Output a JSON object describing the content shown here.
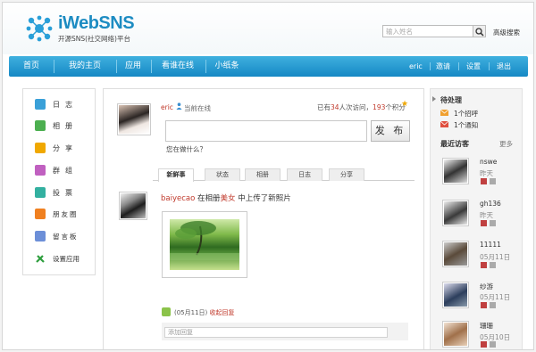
{
  "header": {
    "brand": "iWebSNS",
    "subtitle": "开源SNS(社交网络)平台",
    "search_placeholder": "输入姓名",
    "advanced_search": "高级搜索"
  },
  "nav": {
    "items": [
      {
        "label": "首页"
      },
      {
        "label": "我的主页"
      },
      {
        "label": "应用"
      },
      {
        "label": "看谁在线"
      },
      {
        "label": "小纸条"
      }
    ],
    "user": "eric",
    "invite": "邀请",
    "settings": "设置",
    "logout": "退出"
  },
  "sidebar": {
    "items": [
      {
        "label": "日志",
        "icon": "journal-icon",
        "color": "#3aa0d8"
      },
      {
        "label": "相册",
        "icon": "album-icon",
        "color": "#4caf50"
      },
      {
        "label": "分享",
        "icon": "share-icon",
        "color": "#f0a800"
      },
      {
        "label": "群组",
        "icon": "group-icon",
        "color": "#c060c0"
      },
      {
        "label": "投票",
        "icon": "vote-icon",
        "color": "#33b0a0"
      },
      {
        "label": "朋友圈",
        "icon": "friends-icon",
        "color": "#f08020"
      },
      {
        "label": "留言板",
        "icon": "message-board-icon",
        "color": "#6c8fd8"
      },
      {
        "label": "设置应用",
        "icon": "settings-tools-icon",
        "color": "#2e9e3e"
      }
    ]
  },
  "profile": {
    "username": "eric",
    "status": "当前在线",
    "visits_prefix": "已有",
    "visits_count": "34",
    "visits_mid": "人次访问，",
    "points": "193",
    "points_suffix": "个积分"
  },
  "composer": {
    "publish_label": "发 布",
    "hint": "您在做什么？"
  },
  "tabs": [
    {
      "label": "新鲜事",
      "active": true
    },
    {
      "label": "状态",
      "active": false
    },
    {
      "label": "相册",
      "active": false
    },
    {
      "label": "日志",
      "active": false
    },
    {
      "label": "分享",
      "active": false
    }
  ],
  "feed": {
    "author": "baiyecao",
    "action_prefix": "在相册",
    "album": "美女",
    "action_suffix": "中上传了新照片",
    "date": "(05月11日)",
    "reply_link": "收起回复",
    "reply_placeholder": "添加回复"
  },
  "right": {
    "todo_title": "待处理",
    "todo_items": [
      {
        "label": "1个招呼"
      },
      {
        "label": "1个通知"
      }
    ],
    "visitors_title": "最近访客",
    "more": "更多",
    "visitors": [
      {
        "name": "nswe",
        "date": "昨天"
      },
      {
        "name": "gh136",
        "date": "昨天"
      },
      {
        "name": "11111",
        "date": "05月11日"
      },
      {
        "name": "纱游",
        "date": "05月11日"
      },
      {
        "name": "珊珊",
        "date": "05月10日"
      }
    ]
  }
}
